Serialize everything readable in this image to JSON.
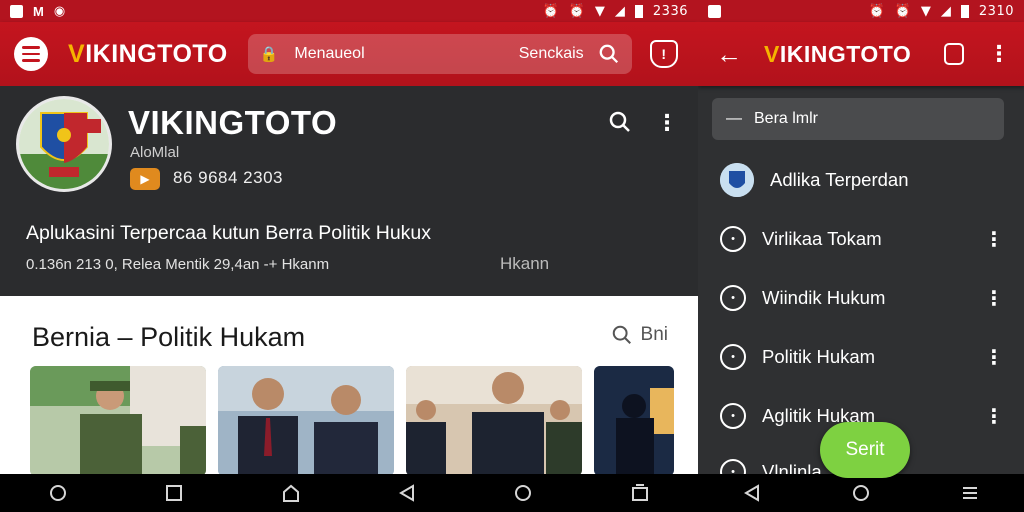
{
  "left": {
    "status": {
      "time": "2336"
    },
    "appbar": {
      "logo_v": "V",
      "logo_rest": "IKINGTOTO",
      "search_text": "Menaueol",
      "search_button": "Senckais"
    },
    "profile": {
      "name": "VIKINGTOTO",
      "subtitle": "AloMlal",
      "stats": "86 9684 2303",
      "title": "Aplukasini Terpercaa kutun Berra Politik Hukux",
      "meta": "0.136n 213 0, Relea Mentik 29,4an -+ Hkanm",
      "meta2": "Hkann"
    },
    "card": {
      "title": "Bernia – Politik Hukam",
      "search_label": "Bni"
    }
  },
  "right": {
    "status": {
      "time": "2310"
    },
    "appbar": {
      "logo_v": "V",
      "logo_rest": "IKINGTOTO"
    },
    "search_text": "Bera lmlr",
    "items": [
      {
        "label": "Adlika Terperdan"
      },
      {
        "label": "Virlikaa Tokam"
      },
      {
        "label": "Wiindik Hukum"
      },
      {
        "label": "Politik Hukam"
      },
      {
        "label": "Aglitik Hukam"
      },
      {
        "label": "Vlnlinla"
      }
    ],
    "fab_label": "Serit"
  },
  "colors": {
    "brand_red": "#c4151f",
    "accent_gold": "#f5b400",
    "fab_green": "#7ed141"
  },
  "icons": [
    "hamburger-icon",
    "lock-icon",
    "search-icon",
    "shield-icon",
    "more-icon",
    "back-arrow-icon",
    "copy-icon",
    "chat-bubble-icon"
  ]
}
